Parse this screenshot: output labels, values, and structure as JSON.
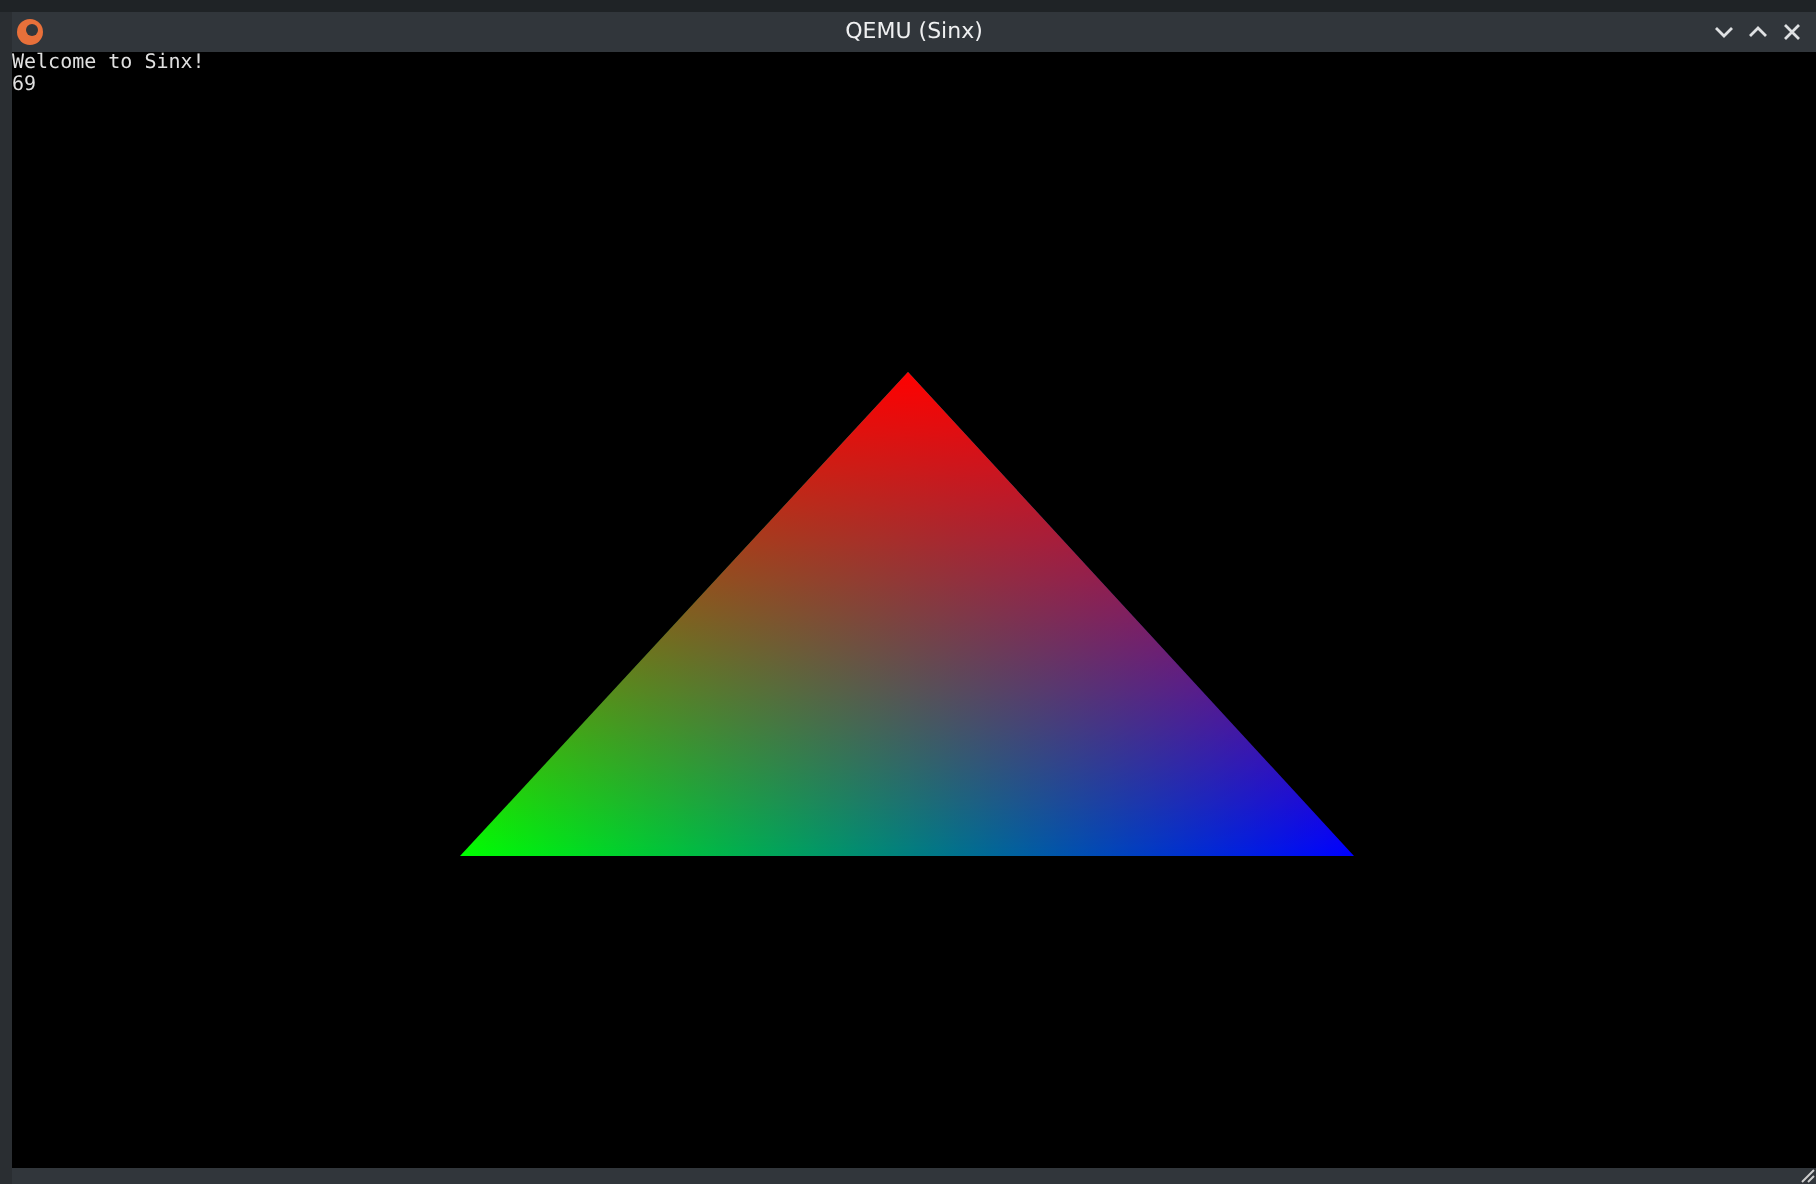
{
  "window": {
    "title": "QEMU (Sinx)",
    "buttons": [
      {
        "kind": "minimize"
      },
      {
        "kind": "maximize"
      },
      {
        "kind": "close"
      }
    ]
  },
  "screen": {
    "lines": [
      "Welcome to Sinx!",
      "69"
    ],
    "kind": "rgb-triangle"
  }
}
